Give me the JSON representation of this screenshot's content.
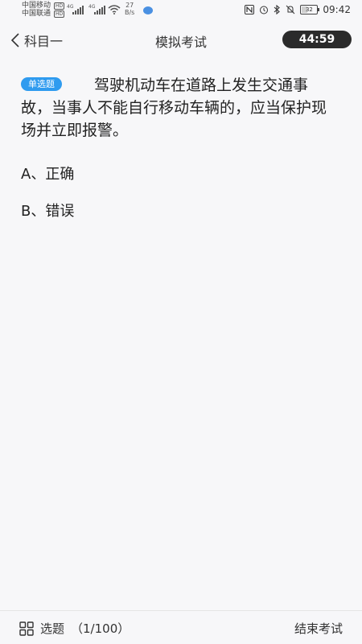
{
  "status_bar": {
    "carrier1": "中国移动",
    "carrier2": "中国联通",
    "hd": "HD",
    "net_tag": "4G",
    "speed_value": "27",
    "speed_unit": "B/s",
    "battery": "32",
    "time": "09:42"
  },
  "header": {
    "back_label": "科目一",
    "title": "模拟考试",
    "timer": "44:59"
  },
  "question": {
    "type_badge": "单选题",
    "text": "驾驶机动车在道路上发生交通事故，当事人不能自行移动车辆的，应当保护现场并立即报警。",
    "options": [
      {
        "label": "A、正确"
      },
      {
        "label": "B、错误"
      }
    ]
  },
  "bottom_bar": {
    "select_label": "选题",
    "progress": "（1/100）",
    "end_label": "结束考试"
  }
}
